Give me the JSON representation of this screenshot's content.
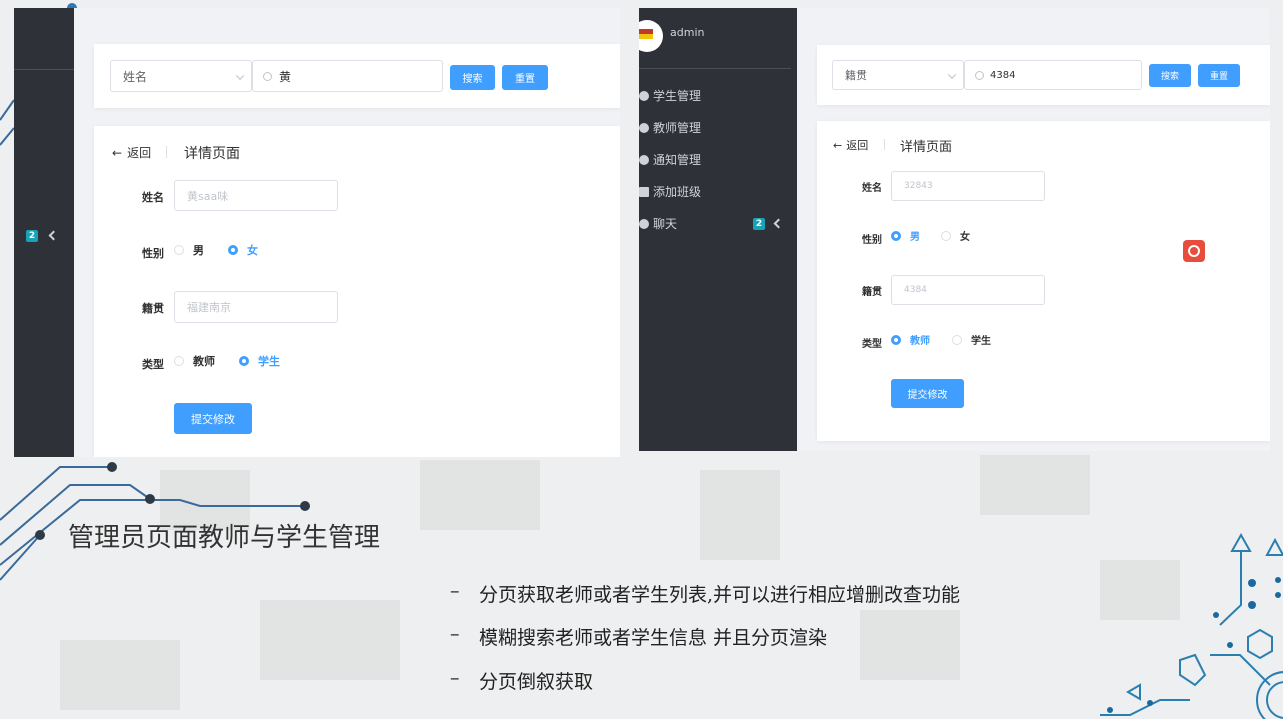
{
  "left": {
    "search": {
      "field_select": "姓名",
      "keyword": "黄",
      "search_button": "搜索",
      "reset_button": "重置"
    },
    "sidebar": {
      "badge": "2"
    },
    "detail": {
      "back_label": "返回",
      "page_title": "详情页面",
      "name_label": "姓名",
      "name_value": "黄saa味",
      "gender_label": "性别",
      "gender_options": [
        "男",
        "女"
      ],
      "gender_selected": "女",
      "origin_label": "籍贯",
      "origin_value": "福建南京",
      "type_label": "类型",
      "type_options": [
        "教师",
        "学生"
      ],
      "type_selected": "学生",
      "submit_button": "提交修改"
    }
  },
  "right": {
    "sidebar": {
      "user": "admin",
      "items": [
        "学生管理",
        "教师管理",
        "通知管理",
        "添加班级",
        "聊天"
      ],
      "chat_badge": "2"
    },
    "search": {
      "field_select": "籍贯",
      "keyword": "4384",
      "search_button": "搜索",
      "reset_button": "重置"
    },
    "detail": {
      "back_label": "返回",
      "page_title": "详情页面",
      "name_label": "姓名",
      "name_value": "32843",
      "gender_label": "性别",
      "gender_options": [
        "男",
        "女"
      ],
      "gender_selected": "男",
      "origin_label": "籍贯",
      "origin_value": "4384",
      "type_label": "类型",
      "type_options": [
        "教师",
        "学生"
      ],
      "type_selected": "教师",
      "submit_button": "提交修改"
    }
  },
  "slide": {
    "heading": "管理员页面教师与学生管理",
    "points": [
      "分页获取老师或者学生列表,并可以进行相应增删改查功能",
      "模糊搜索老师或者学生信息 并且分页渲染",
      "分页倒叙获取"
    ],
    "dash": "–"
  }
}
